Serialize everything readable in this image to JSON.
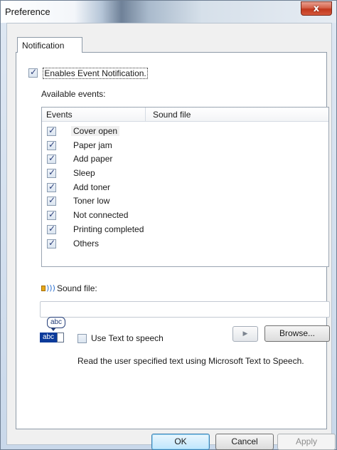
{
  "window": {
    "title": "Preference",
    "close_glyph": "x"
  },
  "tabs": [
    {
      "label": "Notification"
    }
  ],
  "enable_notification": {
    "label": "Enables Event Notification.",
    "checked": true
  },
  "available_events_label": "Available events:",
  "events_table": {
    "columns": [
      "Events",
      "Sound file"
    ],
    "rows": [
      {
        "label": "Cover open",
        "checked": true,
        "selected": true
      },
      {
        "label": "Paper jam",
        "checked": true
      },
      {
        "label": "Add paper",
        "checked": true
      },
      {
        "label": "Sleep",
        "checked": true
      },
      {
        "label": "Add toner",
        "checked": true
      },
      {
        "label": "Toner low",
        "checked": true
      },
      {
        "label": "Not connected",
        "checked": true
      },
      {
        "label": "Printing completed",
        "checked": true
      },
      {
        "label": "Others",
        "checked": true
      }
    ]
  },
  "sound_file": {
    "label": "Sound file:",
    "value": "",
    "icon": "speaker-icon"
  },
  "play_button": {
    "glyph": "▶"
  },
  "browse_button": {
    "label": "Browse..."
  },
  "tts": {
    "icon_top": "abc",
    "icon_bottom": "abc",
    "label": "Use Text to speech",
    "checked": false,
    "description": "Read the user specified text using Microsoft Text to Speech."
  },
  "buttons": {
    "ok": "OK",
    "cancel": "Cancel",
    "apply": "Apply"
  }
}
